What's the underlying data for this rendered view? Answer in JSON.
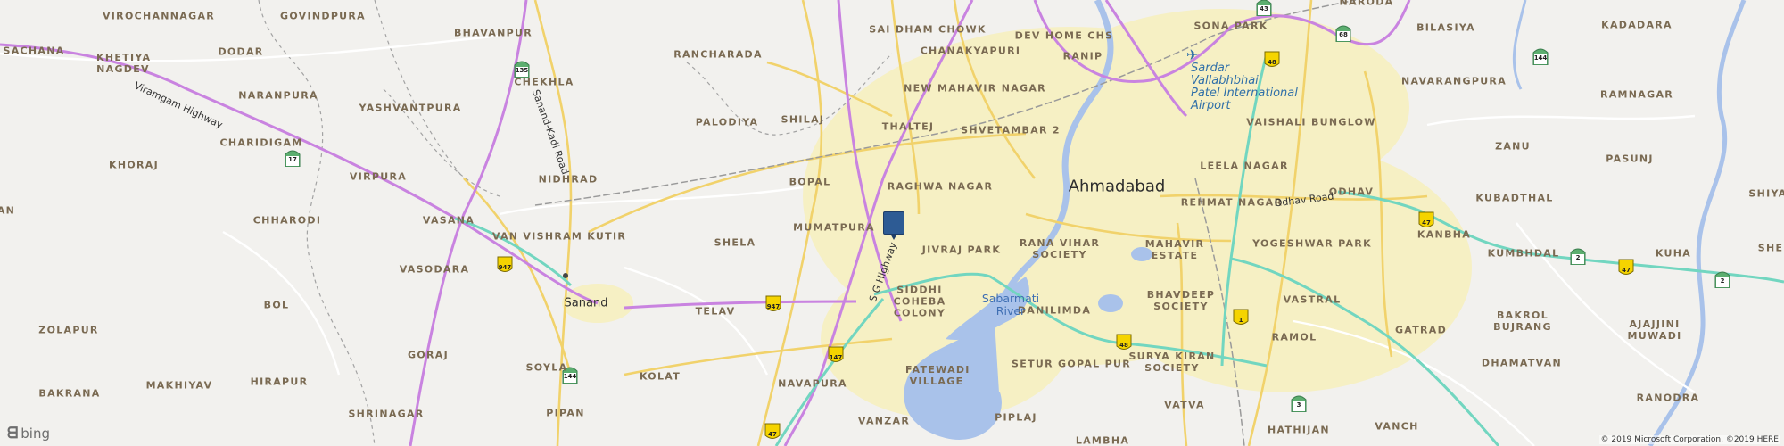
{
  "map": {
    "city": "Ahmedabad",
    "copyright": "© 2019 Microsoft Corporation, ©2019 HERE",
    "bing_logo_text": "bing",
    "marker": "location-marker",
    "colors": {
      "land": "#f2f1ee",
      "urban": "#f6f0c4",
      "water": "#a9c2ea",
      "major_road": "#f1d26b",
      "highway": "#c983e0",
      "expressway": "#72d6c0",
      "rail": "#9a9a9a",
      "boundary": "#9a9a9a",
      "marker": "#2d5b94"
    },
    "place_labels": [
      "VIROCHANNAGAR",
      "GOVINDPURA",
      "SACHANA",
      "KHETIYA NAGDEV",
      "DODAR",
      "BHAVANPUR",
      "CHEKHLA",
      "NARANPURA",
      "YASHVANTPURA",
      "RANCHARADA",
      "PALODIYA",
      "SHILAJ",
      "CHARIDIGAM",
      "KHORAJ",
      "VIRPURA",
      "NIDHRAD",
      "BOPAL",
      "CHHARODI",
      "VASANA",
      "VAN VISHRAM KUTIR",
      "VASODARA",
      "BOL",
      "SHELA",
      "MUMATPURA",
      "ZOLAPUR",
      "GORAJ",
      "MAKHIYAV",
      "HIRAPUR",
      "BAKRANA",
      "SHRINAGAR",
      "KOLAT",
      "SOYLA",
      "PIPAN",
      "NAVAPURA",
      "VANZAR",
      "TELAV",
      "SAI DHAM CHOWK",
      "CHANAKYAPURI",
      "DEV HOME CHS",
      "RANIP",
      "NEW MAHAVIR NAGAR",
      "THALTEJ",
      "SHVETAMBAR 2",
      "RAGHWA NAGAR",
      "JIVRAJ PARK",
      "RANA VIHAR SOCIETY",
      "SIDDHI COHEBA COLONY",
      "FATEWADI VILLAGE",
      "DANILIMDA",
      "SETUR GOPAL PUR",
      "PIPLAJ",
      "LAMBHA",
      "MAHAVIR ESTATE",
      "BHAVDEEP SOCIETY",
      "SURYA KIRAN SOCIETY",
      "VATVA",
      "HATHIJAN",
      "VANCH",
      "RAMOL",
      "VASTRAL",
      "YOGESHWAR PARK",
      "REHMAT NAGAR",
      "LEELA NAGAR",
      "VAISHALI BUNGLOW",
      "SONA PARK",
      "NARODA",
      "BILASIYA",
      "KADADARA",
      "NAVARANGPURA",
      "RAMNAGAR",
      "ZANU",
      "PASUNJ",
      "KUBADTHAL",
      "KANBHA",
      "KUMBHDAL",
      "KUHA",
      "BAKROL BUJRANG",
      "GATRAD",
      "AJAJJINI MUWADI",
      "DHAMATVAN",
      "RANODRA",
      "ODHAV",
      "SHIYA",
      "AN",
      "SHE"
    ],
    "town_labels": [
      "Ahmadabad",
      "Sanand"
    ],
    "water_labels": [
      "Sabarmati River"
    ],
    "airport_label": [
      "Sardar",
      "Vallabhbhai",
      "Patel International",
      "Airport"
    ],
    "road_labels": [
      "Viramgam Highway",
      "Sanand-Kadi Road",
      "S G Highway",
      "Odhav Road"
    ],
    "shields": [
      "43",
      "68",
      "135",
      "17",
      "48",
      "144",
      "947",
      "947",
      "147",
      "144",
      "47",
      "47",
      "47",
      "48",
      "1",
      "3",
      "2",
      "2",
      "47"
    ]
  }
}
